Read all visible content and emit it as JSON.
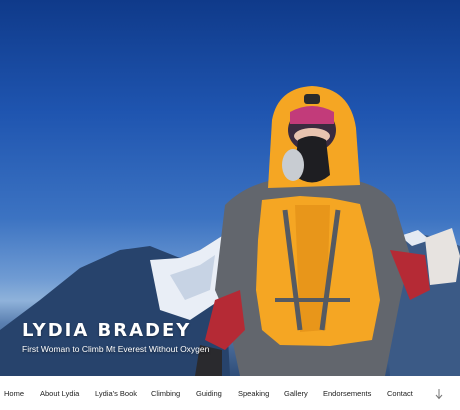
{
  "hero": {
    "title": "LYDIA BRADEY",
    "subtitle": "First Woman to Climb Mt Everest Without Oxygen"
  },
  "nav": {
    "items": [
      "Home",
      "About Lydia",
      "Lydia's Book",
      "Climbing",
      "Guiding",
      "Speaking",
      "Gallery",
      "Endorsements",
      "Contact"
    ],
    "scroll_icon": "arrow-down-icon"
  }
}
